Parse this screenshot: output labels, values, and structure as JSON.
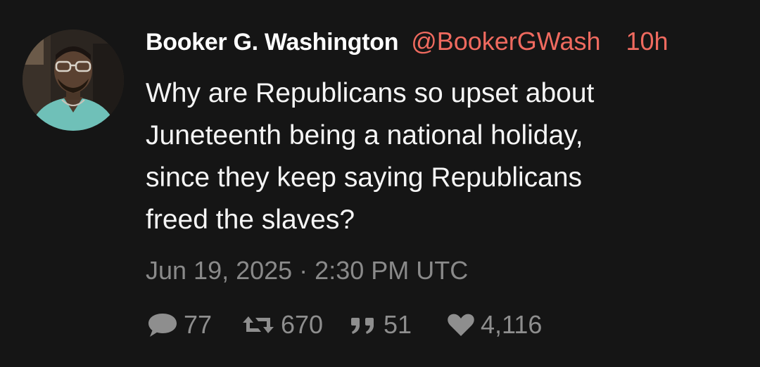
{
  "tweet": {
    "author": {
      "display_name": "Booker G. Washington",
      "handle": "@BookerGWash"
    },
    "time_ago": "10h",
    "text_lines": [
      "Why are Republicans so upset about",
      "Juneteenth being a national holiday,",
      "since they keep saying Republicans",
      "freed the slaves?"
    ],
    "timestamp": "Jun 19, 2025 · 2:30 PM UTC",
    "stats": {
      "replies": "77",
      "retweets": "670",
      "quotes": "51",
      "likes": "4,116"
    }
  },
  "colors": {
    "background": "#151515",
    "accent": "#ef6a5f",
    "text": "#f5f5f5",
    "muted": "#8a8a8a"
  },
  "icons": {
    "replies": "comment-icon",
    "retweets": "retweet-icon",
    "quotes": "quote-icon",
    "likes": "heart-icon"
  }
}
